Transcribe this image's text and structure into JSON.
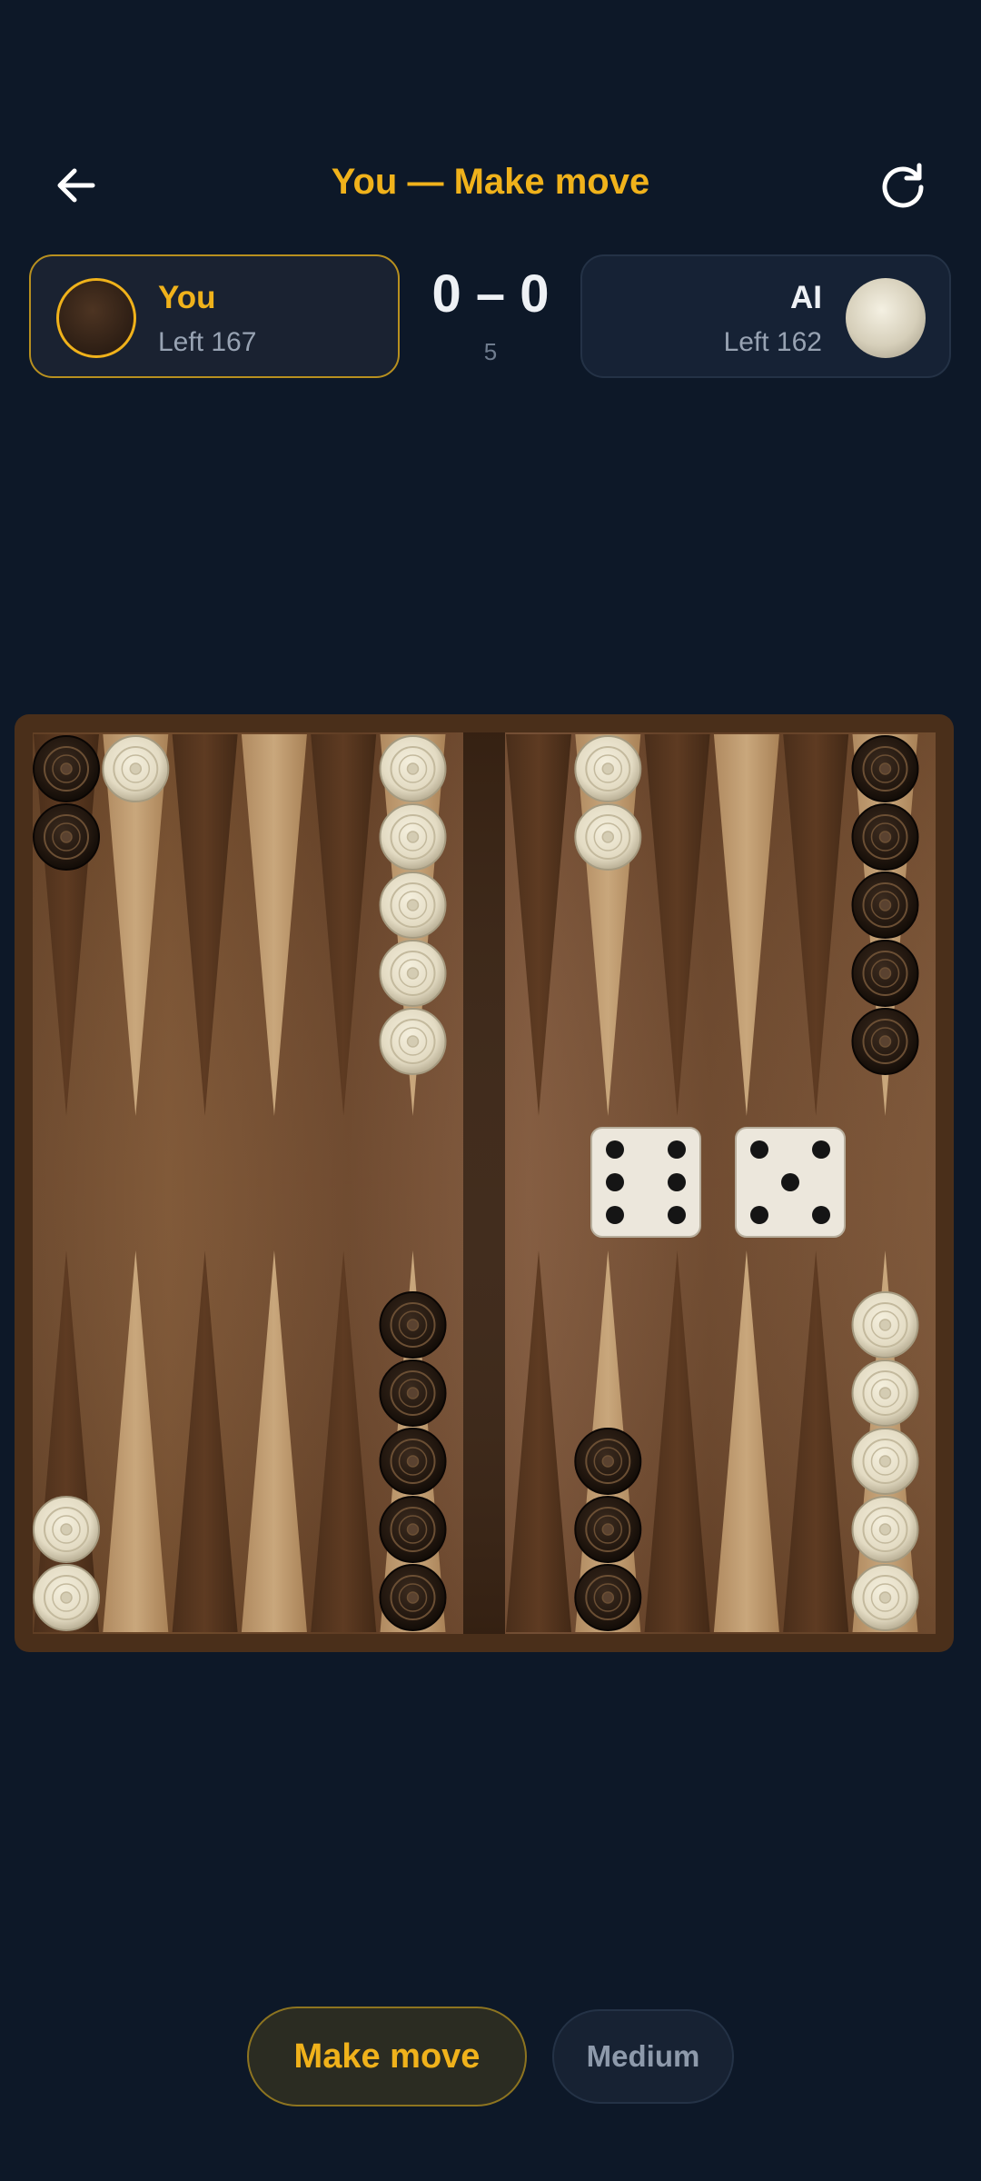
{
  "header": {
    "title": "You — Make move",
    "back_icon": "arrow-left-icon",
    "refresh_icon": "refresh-icon"
  },
  "players": {
    "you": {
      "name": "You",
      "left": "Left 167",
      "checker_color": "dark"
    },
    "ai": {
      "name": "AI",
      "left": "Left 162",
      "checker_color": "light"
    }
  },
  "score": {
    "text": "0 – 0",
    "sub": "5"
  },
  "board": {
    "top_points": [
      {
        "color": "dark",
        "count": 2
      },
      {
        "color": "light",
        "count": 1
      },
      {
        "color": null,
        "count": 0
      },
      {
        "color": null,
        "count": 0
      },
      {
        "color": null,
        "count": 0
      },
      {
        "color": "light",
        "count": 5
      },
      {
        "color": null,
        "count": 0
      },
      {
        "color": "light",
        "count": 2
      },
      {
        "color": null,
        "count": 0
      },
      {
        "color": null,
        "count": 0
      },
      {
        "color": null,
        "count": 0
      },
      {
        "color": "dark",
        "count": 5
      }
    ],
    "bottom_points": [
      {
        "color": "light",
        "count": 2
      },
      {
        "color": null,
        "count": 0
      },
      {
        "color": null,
        "count": 0
      },
      {
        "color": null,
        "count": 0
      },
      {
        "color": null,
        "count": 0
      },
      {
        "color": "dark",
        "count": 5
      },
      {
        "color": null,
        "count": 0
      },
      {
        "color": "dark",
        "count": 3
      },
      {
        "color": null,
        "count": 0
      },
      {
        "color": null,
        "count": 0
      },
      {
        "color": null,
        "count": 0
      },
      {
        "color": "light",
        "count": 5
      }
    ],
    "dice": [
      6,
      5
    ]
  },
  "actions": {
    "make_move": "Make move",
    "difficulty": "Medium"
  },
  "colors": {
    "background": "#0d1828",
    "accent": "#f0b21b",
    "card": "#162235",
    "wood_dark": "#5a3a22",
    "wood_light": "#b08a5e"
  }
}
